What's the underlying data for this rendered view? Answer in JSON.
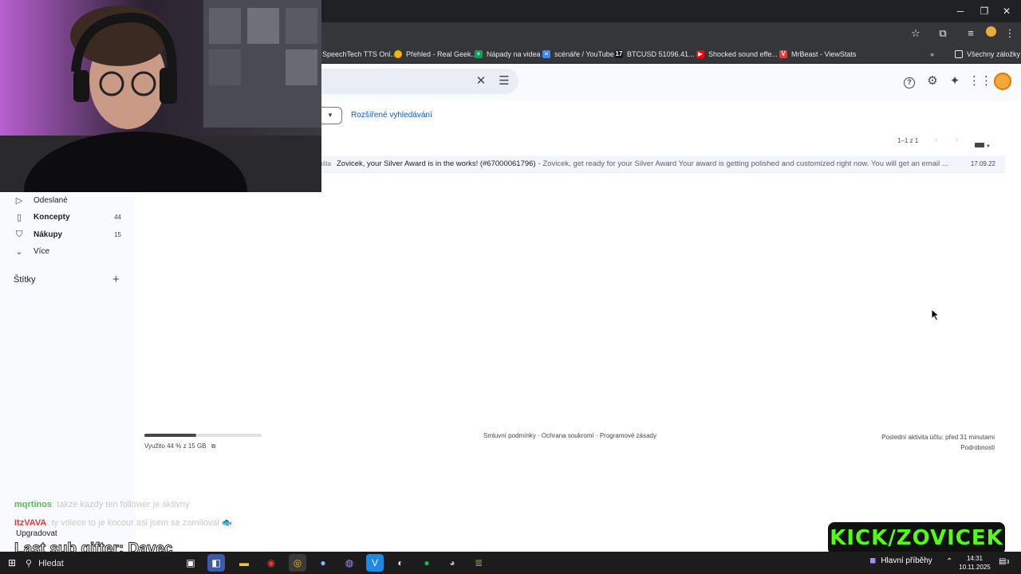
{
  "browser": {
    "bookmarks": [
      {
        "label": "SpeechTech TTS Onl...",
        "icon": "speechtech-icon",
        "color": "#35363a"
      },
      {
        "label": "Přehled - Real Geek...",
        "icon": "bulb-icon",
        "color": "#f4b400"
      },
      {
        "label": "Nápady na videa",
        "icon": "sheets-icon",
        "color": "#0f9d58"
      },
      {
        "label": "scénáře / YouTube",
        "icon": "docs-icon",
        "color": "#4285f4"
      },
      {
        "label": "BTCUSD 51096.41...",
        "icon": "tradingview-icon",
        "color": "#131722"
      },
      {
        "label": "Shocked sound effe...",
        "icon": "youtube-icon",
        "color": "#ff0000"
      },
      {
        "label": "MrBeast - ViewStats",
        "icon": "viewstats-icon",
        "color": "#e53935"
      }
    ],
    "all_bookmarks": "Všechny záložky",
    "more_bookmarks": "»"
  },
  "gmail": {
    "advanced_search": "Rozšířené vyhledávání",
    "pager": "1–1 z 1",
    "sidebar": [
      {
        "label": "Odeslané",
        "count": "",
        "icon": "send-icon",
        "bold": false
      },
      {
        "label": "Koncepty",
        "count": "44",
        "icon": "draft-icon",
        "bold": true
      },
      {
        "label": "Nákupy",
        "count": "15",
        "icon": "shopping-bag-icon",
        "bold": true
      },
      {
        "label": "Více",
        "count": "",
        "icon": "chevron-down-icon",
        "bold": false
      }
    ],
    "labels_heading": "Štítky",
    "email": {
      "tag": "ošta",
      "subject": "Zovicek, your Silver Award is in the works! (#67000061796)",
      "snippet": "- Zovicek, get ready for your Silver Award Your award is getting polished and customized right now. You will get an email ...",
      "date": "17.09.22"
    },
    "storage": {
      "text": "Využito 44 % z 15 GB",
      "fraction": 0.44
    },
    "footer_links": "Smluvní podmínky · Ochrana soukromí · Programové zásady",
    "last_activity": "Poslední aktivita účtu: před 31 minutami",
    "details": "Podrobnosti"
  },
  "stream": {
    "chat": [
      {
        "user": "mqrtinos",
        "text": ": takze kazdy ten follower je aktivny"
      },
      {
        "user": "ItzVAVA",
        "text": ": ty volece to je kocour asi jsem se zamiloval 🐟"
      }
    ],
    "upgrade": "Upgradovat",
    "last_sub_gifter": "Last sub gifter: Davec",
    "kick_brand": "KICK/ZOVICEK"
  },
  "taskbar": {
    "search_label": "Hledat",
    "news_label": "Hlavní příběhy",
    "time": "14:31",
    "date": "10.11.2025",
    "notifications": "3"
  }
}
